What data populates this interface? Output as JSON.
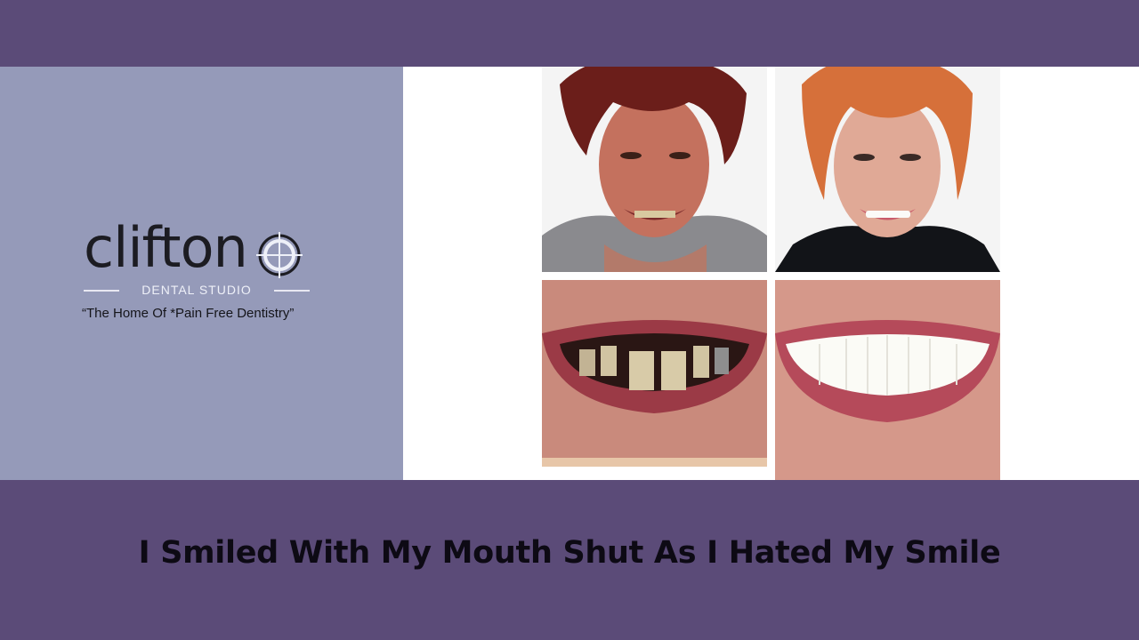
{
  "brand": {
    "name": "clifton",
    "subtitle": "DENTAL STUDIO",
    "tagline": "“The Home Of *Pain Free Dentistry”"
  },
  "photos": {
    "before_face": "before-face-photo",
    "after_face": "after-face-photo",
    "before_teeth": "before-teeth-photo",
    "after_teeth": "after-teeth-photo"
  },
  "caption": "I Smiled With My Mouth Shut As I Hated My Smile",
  "colors": {
    "band": "#5b4b78",
    "logo_panel": "#959ab9",
    "photo_panel": "#ffffff"
  }
}
